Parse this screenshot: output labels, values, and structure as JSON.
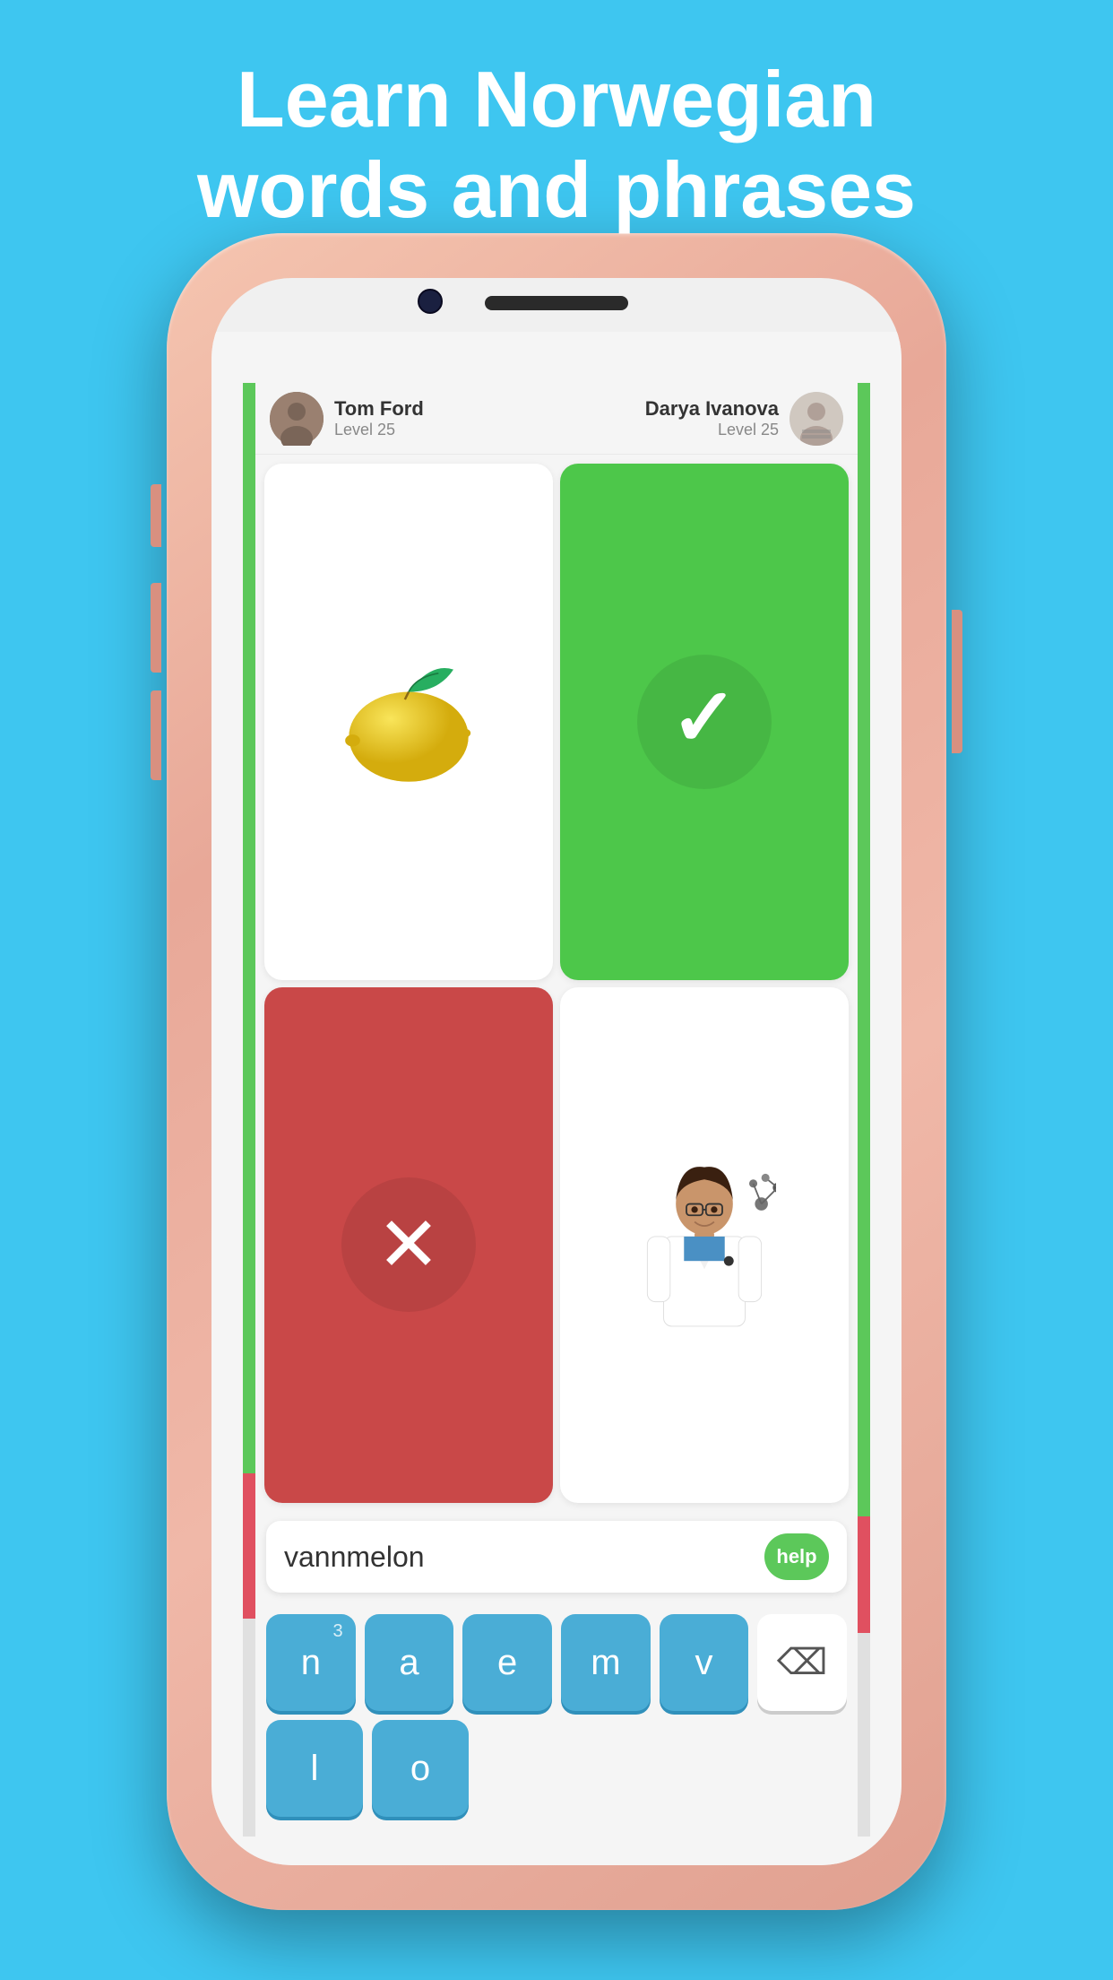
{
  "page": {
    "title_line1": "Learn Norwegian",
    "title_line2": "words and phrases",
    "background_color": "#3EC6F0"
  },
  "players": {
    "left": {
      "name": "Tom Ford",
      "level": "Level 25",
      "avatar_emoji": "👤"
    },
    "right": {
      "name": "Darya Ivanova",
      "level": "Level 25",
      "avatar_emoji": "👩"
    }
  },
  "grid": {
    "cells": [
      {
        "id": "lemon",
        "type": "image",
        "label": "Lemon"
      },
      {
        "id": "correct",
        "type": "correct",
        "label": "Correct answer"
      },
      {
        "id": "wrong",
        "type": "wrong",
        "label": "Wrong answer"
      },
      {
        "id": "scientist",
        "type": "image",
        "label": "Scientist"
      }
    ]
  },
  "input": {
    "word": "vannmelon",
    "help_label": "help"
  },
  "keyboard": {
    "row1": [
      {
        "key": "n",
        "superscript": "3"
      },
      {
        "key": "a",
        "superscript": ""
      },
      {
        "key": "e",
        "superscript": ""
      },
      {
        "key": "m",
        "superscript": ""
      },
      {
        "key": "v",
        "superscript": ""
      },
      {
        "key": "⌫",
        "type": "delete"
      }
    ],
    "row2": [
      {
        "key": "l",
        "superscript": ""
      },
      {
        "key": "o",
        "superscript": ""
      }
    ]
  }
}
